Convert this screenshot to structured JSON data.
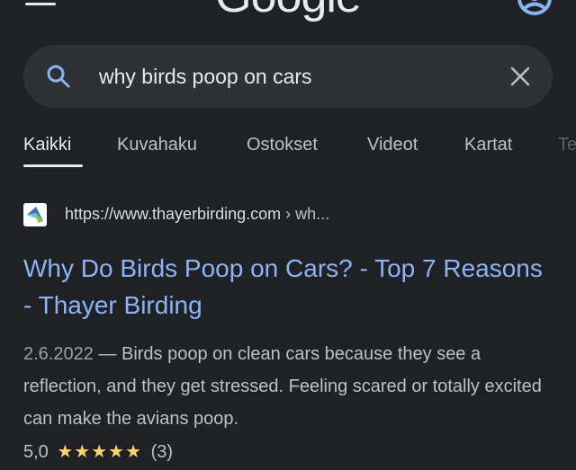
{
  "header": {
    "logo_text": "Google"
  },
  "search": {
    "query": "why birds poop on cars"
  },
  "tabs": [
    {
      "label": "Kaikki",
      "active": true
    },
    {
      "label": "Kuvahaku",
      "active": false
    },
    {
      "label": "Ostokset",
      "active": false
    },
    {
      "label": "Videot",
      "active": false
    },
    {
      "label": "Kartat",
      "active": false
    },
    {
      "label": "Te",
      "active": false
    }
  ],
  "result": {
    "url": "https://www.thayerbirding.com",
    "breadcrumb": " › wh...",
    "title": "Why Do Birds Poop on Cars? - Top 7 Reasons - Thayer Birding",
    "date": "2.6.2022",
    "snippet": " — Birds poop on clean cars because they see a reflection, and they get stressed. Feeling scared or totally excited can make the avians poop.",
    "rating_value": "5,0",
    "stars_text": "★★★★★",
    "stars": 5,
    "review_count": "(3)"
  },
  "colors": {
    "background": "#202124",
    "searchbox": "#303134",
    "link": "#8ab4f8",
    "star": "#fdd663"
  }
}
